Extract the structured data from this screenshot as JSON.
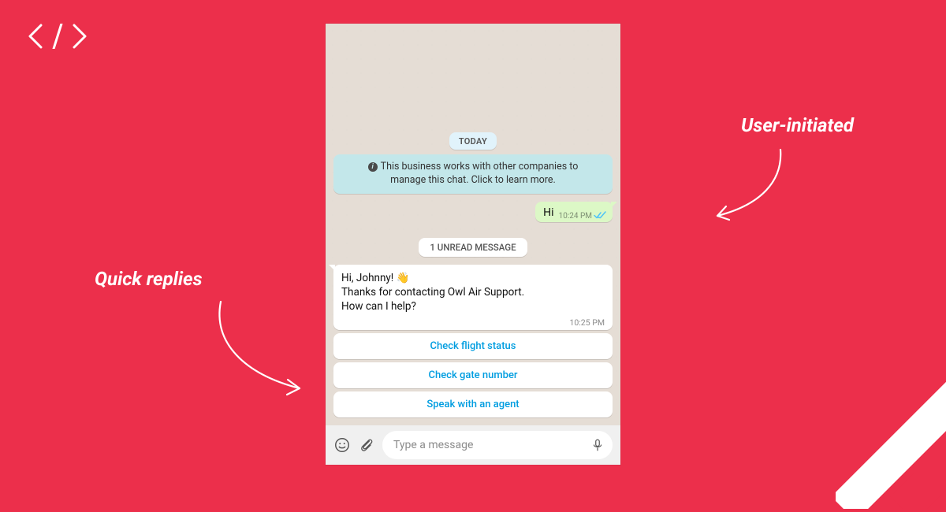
{
  "annotations": {
    "user_initiated": "User-initiated",
    "quick_replies": "Quick replies"
  },
  "chat": {
    "date_label": "TODAY",
    "system_notice_line1": "This business works with other companies to",
    "system_notice_line2": "manage this chat. Click to learn more.",
    "outgoing_msg": "Hi",
    "outgoing_time": "10:24 PM",
    "unread_label": "1 UNREAD MESSAGE",
    "incoming_msg": "Hi, Johnny! 👋\nThanks for contacting Owl Air Support.\nHow can I help?",
    "incoming_time": "10:25 PM",
    "quick_replies": [
      {
        "label": "Check flight status"
      },
      {
        "label": "Check gate number"
      },
      {
        "label": "Speak with an agent"
      }
    ],
    "compose_placeholder": "Type a message"
  }
}
